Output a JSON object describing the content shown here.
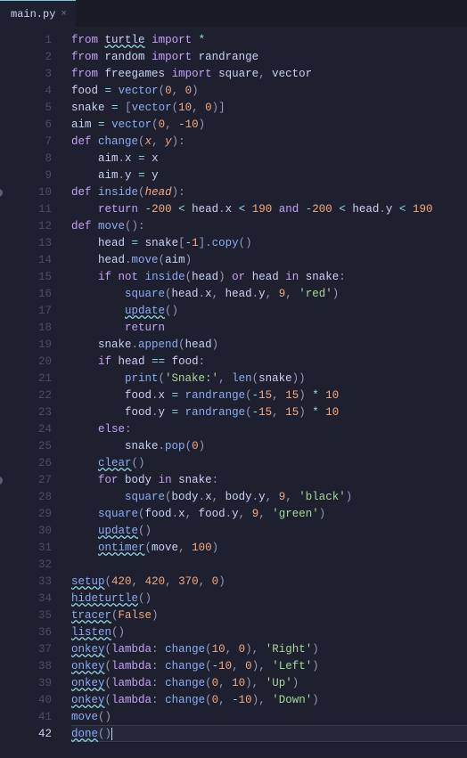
{
  "tab": {
    "title": "main.py",
    "close": "×"
  },
  "breakpoints": [
    10,
    27
  ],
  "current_line": 42,
  "lines": [
    {
      "n": 1,
      "html": "<span class='kw'>from</span> <span class='ident squiggle'>turtle</span> <span class='kw'>import</span> <span class='op'>*</span>"
    },
    {
      "n": 2,
      "html": "<span class='kw'>from</span> <span class='ident'>random</span> <span class='kw'>import</span> <span class='ident'>randrange</span>"
    },
    {
      "n": 3,
      "html": "<span class='kw'>from</span> <span class='ident'>freegames</span> <span class='kw'>import</span> <span class='ident'>square</span><span class='punct'>,</span> <span class='ident'>vector</span>"
    },
    {
      "n": 4,
      "html": "<span class='ident'>food</span> <span class='op'>=</span> <span class='fn'>vector</span><span class='punct'>(</span><span class='num'>0</span><span class='punct'>,</span> <span class='num'>0</span><span class='punct'>)</span>"
    },
    {
      "n": 5,
      "html": "<span class='ident'>snake</span> <span class='op'>=</span> <span class='punct'>[</span><span class='fn'>vector</span><span class='punct'>(</span><span class='num'>10</span><span class='punct'>,</span> <span class='num'>0</span><span class='punct'>)]</span>"
    },
    {
      "n": 6,
      "html": "<span class='ident'>aim</span> <span class='op'>=</span> <span class='fn'>vector</span><span class='punct'>(</span><span class='num'>0</span><span class='punct'>,</span> <span class='op'>-</span><span class='num'>10</span><span class='punct'>)</span>"
    },
    {
      "n": 7,
      "html": "<span class='kw'>def</span> <span class='fn-def'>change</span><span class='punct'>(</span><span class='param'>x</span><span class='punct'>,</span> <span class='param'>y</span><span class='punct'>):</span>"
    },
    {
      "n": 8,
      "html": "    <span class='ident'>aim</span><span class='punct'>.</span><span class='ident'>x</span> <span class='op'>=</span> <span class='ident'>x</span>"
    },
    {
      "n": 9,
      "html": "    <span class='ident'>aim</span><span class='punct'>.</span><span class='ident'>y</span> <span class='op'>=</span> <span class='ident'>y</span>"
    },
    {
      "n": 10,
      "html": "<span class='kw'>def</span> <span class='fn-def'>inside</span><span class='punct'>(</span><span class='param'>head</span><span class='punct'>):</span>"
    },
    {
      "n": 11,
      "html": "    <span class='kw'>return</span> <span class='op'>-</span><span class='num'>200</span> <span class='op'>&lt;</span> <span class='ident'>head</span><span class='punct'>.</span><span class='ident'>x</span> <span class='op'>&lt;</span> <span class='num'>190</span> <span class='kw'>and</span> <span class='op'>-</span><span class='num'>200</span> <span class='op'>&lt;</span> <span class='ident'>head</span><span class='punct'>.</span><span class='ident'>y</span> <span class='op'>&lt;</span> <span class='num'>190</span>"
    },
    {
      "n": 12,
      "html": "<span class='kw'>def</span> <span class='fn-def'>move</span><span class='punct'>():</span>"
    },
    {
      "n": 13,
      "html": "    <span class='ident'>head</span> <span class='op'>=</span> <span class='ident'>snake</span><span class='punct'>[</span><span class='op'>-</span><span class='num'>1</span><span class='punct'>].</span><span class='fn'>copy</span><span class='punct'>()</span>"
    },
    {
      "n": 14,
      "html": "    <span class='ident'>head</span><span class='punct'>.</span><span class='fn'>move</span><span class='punct'>(</span><span class='ident'>aim</span><span class='punct'>)</span>"
    },
    {
      "n": 15,
      "html": "    <span class='kw'>if</span> <span class='kw'>not</span> <span class='fn'>inside</span><span class='punct'>(</span><span class='ident'>head</span><span class='punct'>)</span> <span class='kw'>or</span> <span class='ident'>head</span> <span class='kw'>in</span> <span class='ident'>snake</span><span class='punct'>:</span>"
    },
    {
      "n": 16,
      "html": "        <span class='fn'>square</span><span class='punct'>(</span><span class='ident'>head</span><span class='punct'>.</span><span class='ident'>x</span><span class='punct'>,</span> <span class='ident'>head</span><span class='punct'>.</span><span class='ident'>y</span><span class='punct'>,</span> <span class='num'>9</span><span class='punct'>,</span> <span class='str'>'red'</span><span class='punct'>)</span>"
    },
    {
      "n": 17,
      "html": "        <span class='fn squiggle'>update</span><span class='punct'>()</span>"
    },
    {
      "n": 18,
      "html": "        <span class='kw'>return</span>"
    },
    {
      "n": 19,
      "html": "    <span class='ident'>snake</span><span class='punct'>.</span><span class='fn'>append</span><span class='punct'>(</span><span class='ident'>head</span><span class='punct'>)</span>"
    },
    {
      "n": 20,
      "html": "    <span class='kw'>if</span> <span class='ident'>head</span> <span class='op'>==</span> <span class='ident'>food</span><span class='punct'>:</span>"
    },
    {
      "n": 21,
      "html": "        <span class='builtin'>print</span><span class='punct'>(</span><span class='str'>'Snake:'</span><span class='punct'>,</span> <span class='builtin'>len</span><span class='punct'>(</span><span class='ident'>snake</span><span class='punct'>))</span>"
    },
    {
      "n": 22,
      "html": "        <span class='ident'>food</span><span class='punct'>.</span><span class='ident'>x</span> <span class='op'>=</span> <span class='fn'>randrange</span><span class='punct'>(</span><span class='op'>-</span><span class='num'>15</span><span class='punct'>,</span> <span class='num'>15</span><span class='punct'>)</span> <span class='op'>*</span> <span class='num'>10</span>"
    },
    {
      "n": 23,
      "html": "        <span class='ident'>food</span><span class='punct'>.</span><span class='ident'>y</span> <span class='op'>=</span> <span class='fn'>randrange</span><span class='punct'>(</span><span class='op'>-</span><span class='num'>15</span><span class='punct'>,</span> <span class='num'>15</span><span class='punct'>)</span> <span class='op'>*</span> <span class='num'>10</span>"
    },
    {
      "n": 24,
      "html": "    <span class='kw'>else</span><span class='punct'>:</span>"
    },
    {
      "n": 25,
      "html": "        <span class='ident'>snake</span><span class='punct'>.</span><span class='fn'>pop</span><span class='punct'>(</span><span class='num'>0</span><span class='punct'>)</span>"
    },
    {
      "n": 26,
      "html": "    <span class='fn squiggle'>clear</span><span class='punct'>()</span>"
    },
    {
      "n": 27,
      "html": "    <span class='kw'>for</span> <span class='ident'>body</span> <span class='kw'>in</span> <span class='ident'>snake</span><span class='punct'>:</span>"
    },
    {
      "n": 28,
      "html": "        <span class='fn'>square</span><span class='punct'>(</span><span class='ident'>body</span><span class='punct'>.</span><span class='ident'>x</span><span class='punct'>,</span> <span class='ident'>body</span><span class='punct'>.</span><span class='ident'>y</span><span class='punct'>,</span> <span class='num'>9</span><span class='punct'>,</span> <span class='str'>'black'</span><span class='punct'>)</span>"
    },
    {
      "n": 29,
      "html": "    <span class='fn'>square</span><span class='punct'>(</span><span class='ident'>food</span><span class='punct'>.</span><span class='ident'>x</span><span class='punct'>,</span> <span class='ident'>food</span><span class='punct'>.</span><span class='ident'>y</span><span class='punct'>,</span> <span class='num'>9</span><span class='punct'>,</span> <span class='str'>'green'</span><span class='punct'>)</span>"
    },
    {
      "n": 30,
      "html": "    <span class='fn squiggle'>update</span><span class='punct'>()</span>"
    },
    {
      "n": 31,
      "html": "    <span class='fn squiggle'>ontimer</span><span class='punct'>(</span><span class='ident'>move</span><span class='punct'>,</span> <span class='num'>100</span><span class='punct'>)</span>"
    },
    {
      "n": 32,
      "html": ""
    },
    {
      "n": 33,
      "html": "<span class='fn squiggle'>setup</span><span class='punct'>(</span><span class='num'>420</span><span class='punct'>,</span> <span class='num'>420</span><span class='punct'>,</span> <span class='num'>370</span><span class='punct'>,</span> <span class='num'>0</span><span class='punct'>)</span>"
    },
    {
      "n": 34,
      "html": "<span class='fn squiggle'>hideturtle</span><span class='punct'>()</span>"
    },
    {
      "n": 35,
      "html": "<span class='fn squiggle'>tracer</span><span class='punct'>(</span><span class='const'>False</span><span class='punct'>)</span>"
    },
    {
      "n": 36,
      "html": "<span class='fn squiggle'>listen</span><span class='punct'>()</span>"
    },
    {
      "n": 37,
      "html": "<span class='fn squiggle'>onkey</span><span class='punct'>(</span><span class='kw'>lambda</span><span class='punct'>:</span> <span class='fn'>change</span><span class='punct'>(</span><span class='num'>10</span><span class='punct'>,</span> <span class='num'>0</span><span class='punct'>),</span> <span class='str'>'Right'</span><span class='punct'>)</span>"
    },
    {
      "n": 38,
      "html": "<span class='fn squiggle'>onkey</span><span class='punct'>(</span><span class='kw'>lambda</span><span class='punct'>:</span> <span class='fn'>change</span><span class='punct'>(</span><span class='op'>-</span><span class='num'>10</span><span class='punct'>,</span> <span class='num'>0</span><span class='punct'>),</span> <span class='str'>'Left'</span><span class='punct'>)</span>"
    },
    {
      "n": 39,
      "html": "<span class='fn squiggle'>onkey</span><span class='punct'>(</span><span class='kw'>lambda</span><span class='punct'>:</span> <span class='fn'>change</span><span class='punct'>(</span><span class='num'>0</span><span class='punct'>,</span> <span class='num'>10</span><span class='punct'>),</span> <span class='str'>'Up'</span><span class='punct'>)</span>"
    },
    {
      "n": 40,
      "html": "<span class='fn squiggle'>onkey</span><span class='punct'>(</span><span class='kw'>lambda</span><span class='punct'>:</span> <span class='fn'>change</span><span class='punct'>(</span><span class='num'>0</span><span class='punct'>,</span> <span class='op'>-</span><span class='num'>10</span><span class='punct'>),</span> <span class='str'>'Down'</span><span class='punct'>)</span>"
    },
    {
      "n": 41,
      "html": "<span class='fn'>move</span><span class='punct'>()</span>"
    },
    {
      "n": 42,
      "html": "<span class='fn squiggle'>done</span><span class='punct'>()</span><span class='cursor'></span>"
    }
  ]
}
